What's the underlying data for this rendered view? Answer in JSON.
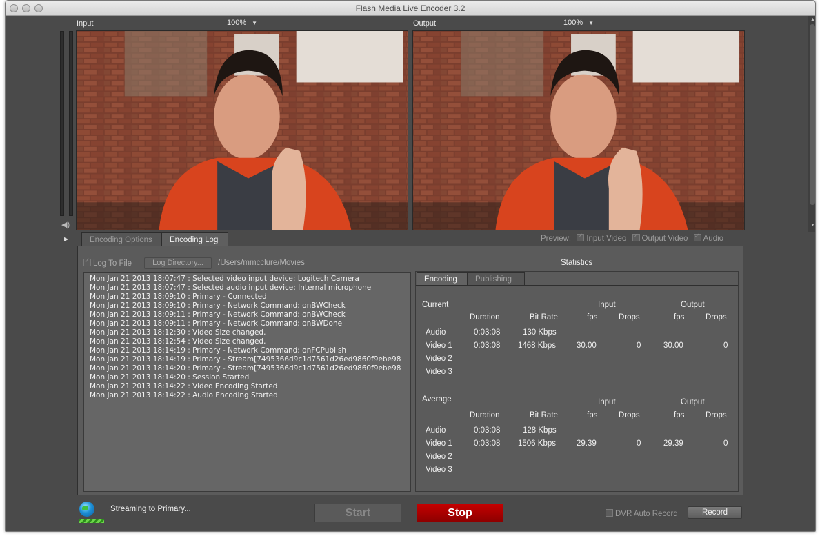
{
  "app": {
    "title": "Flash Media Live Encoder 3.2"
  },
  "input": {
    "label": "Input",
    "zoom": "100%"
  },
  "output": {
    "label": "Output",
    "zoom": "100%"
  },
  "tabs": [
    {
      "label": "Encoding Options",
      "active": false
    },
    {
      "label": "Encoding Log",
      "active": true
    }
  ],
  "preview": {
    "label": "Preview:",
    "input_video": "Input Video",
    "output_video": "Output Video",
    "audio": "Audio"
  },
  "log": {
    "log_to_file": "Log To File",
    "log_directory_button": "Log Directory...",
    "directory_path": "/Users/mmcclure/Movies",
    "lines": [
      "Mon Jan 21 2013 18:07:47 : Selected video input device: Logitech Camera",
      "Mon Jan 21 2013 18:07:47 : Selected audio input device: Internal microphone",
      "Mon Jan 21 2013 18:09:10 : Primary - Connected",
      "Mon Jan 21 2013 18:09:10 : Primary - Network Command: onBWCheck",
      "Mon Jan 21 2013 18:09:11 : Primary - Network Command: onBWCheck",
      "Mon Jan 21 2013 18:09:11 : Primary - Network Command: onBWDone",
      "Mon Jan 21 2013 18:12:30 : Video Size  changed.",
      "Mon Jan 21 2013 18:12:54 : Video Size  changed.",
      "Mon Jan 21 2013 18:14:19 : Primary - Network Command: onFCPublish",
      "Mon Jan 21 2013 18:14:19 : Primary - Stream[7495366d9c1d7561d26ed9860f9ebe98",
      "Mon Jan 21 2013 18:14:20 : Primary - Stream[7495366d9c1d7561d26ed9860f9ebe98",
      "Mon Jan 21 2013 18:14:20 : Session Started",
      "Mon Jan 21 2013 18:14:22 : Video Encoding Started",
      "Mon Jan 21 2013 18:14:22 : Audio Encoding Started"
    ]
  },
  "statistics": {
    "title": "Statistics",
    "tabs": [
      "Encoding",
      "Publishing"
    ],
    "current": {
      "label": "Current",
      "headers": {
        "duration": "Duration",
        "bitrate": "Bit Rate",
        "input": "Input",
        "output": "Output",
        "fps": "fps",
        "drops": "Drops"
      },
      "rows": [
        {
          "name": "Audio",
          "duration": "0:03:08",
          "bitrate": "130 Kbps",
          "in_fps": "",
          "in_drops": "",
          "out_fps": "",
          "out_drops": ""
        },
        {
          "name": "Video 1",
          "duration": "0:03:08",
          "bitrate": "1468 Kbps",
          "in_fps": "30.00",
          "in_drops": "0",
          "out_fps": "30.00",
          "out_drops": "0"
        },
        {
          "name": "Video 2",
          "duration": "",
          "bitrate": "",
          "in_fps": "",
          "in_drops": "",
          "out_fps": "",
          "out_drops": ""
        },
        {
          "name": "Video 3",
          "duration": "",
          "bitrate": "",
          "in_fps": "",
          "in_drops": "",
          "out_fps": "",
          "out_drops": ""
        }
      ]
    },
    "average": {
      "label": "Average",
      "headers": {
        "duration": "Duration",
        "bitrate": "Bit Rate",
        "input": "Input",
        "output": "Output",
        "fps": "fps",
        "drops": "Drops"
      },
      "rows": [
        {
          "name": "Audio",
          "duration": "0:03:08",
          "bitrate": "128 Kbps",
          "in_fps": "",
          "in_drops": "",
          "out_fps": "",
          "out_drops": ""
        },
        {
          "name": "Video 1",
          "duration": "0:03:08",
          "bitrate": "1506 Kbps",
          "in_fps": "29.39",
          "in_drops": "0",
          "out_fps": "29.39",
          "out_drops": "0"
        },
        {
          "name": "Video 2",
          "duration": "",
          "bitrate": "",
          "in_fps": "",
          "in_drops": "",
          "out_fps": "",
          "out_drops": ""
        },
        {
          "name": "Video 3",
          "duration": "",
          "bitrate": "",
          "in_fps": "",
          "in_drops": "",
          "out_fps": "",
          "out_drops": ""
        }
      ]
    }
  },
  "status": {
    "streaming_text": "Streaming to Primary..."
  },
  "controls": {
    "start": "Start",
    "stop": "Stop",
    "dvr_auto_record": "DVR Auto Record",
    "record": "Record"
  },
  "colors": {
    "stop_button": "#b00000",
    "window_bg": "#4a4a4a",
    "panel_bg": "#5b5b5b"
  }
}
